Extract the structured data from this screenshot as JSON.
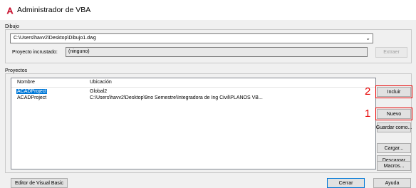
{
  "window": {
    "title": "Administrador de VBA",
    "icon": "autocad-a-icon",
    "accent_color": "#c8102e"
  },
  "drawing": {
    "group_label": "Dibujo",
    "selected_path": "C:\\Users\\havv2\\Desktop\\Dibujo1.dwg",
    "embedded_label": "Proyecto incrustado:",
    "embedded_value": "(ninguno)",
    "extract_button": "Extraer"
  },
  "projects": {
    "group_label": "Proyectos",
    "columns": [
      "Nombre",
      "Ubicación"
    ],
    "rows": [
      {
        "name": "ACADProject",
        "location": "Global2",
        "selected": true
      },
      {
        "name": "ACADProject",
        "location": "C:\\Users\\havv2\\Desktop\\9no Semestre\\Integradora de Ing Civil\\PLANOS VB..."
      }
    ]
  },
  "side_buttons": {
    "load": "Incluir",
    "new": "Nuevo",
    "save_as": "Guardar como...",
    "upload": "Cargar...",
    "unload": "Descargar",
    "macros": "Macros..."
  },
  "footer": {
    "vb_editor": "Editor de Visual Basic",
    "close": "Cerrar",
    "help": "Ayuda"
  },
  "annotations": {
    "marker_2": "2",
    "marker_1": "1",
    "color": "#e60000"
  }
}
